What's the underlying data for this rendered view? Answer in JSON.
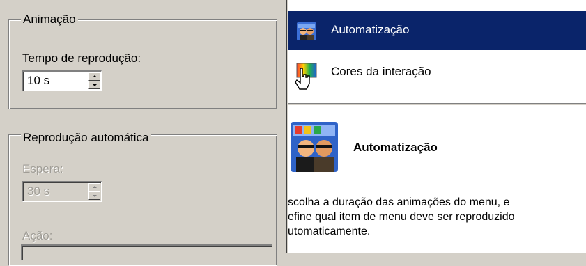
{
  "animation_group": {
    "title": "Animação",
    "playback_time_label": "Tempo de reprodução:",
    "playback_time_value": "10 s"
  },
  "autoplay_group": {
    "title": "Reprodução automática",
    "wait_label": "Espera:",
    "wait_value": "30 s",
    "action_label": "Ação:"
  },
  "menu": {
    "items": [
      {
        "label": "Automatização",
        "icon": "people-automation-icon",
        "selected": true
      },
      {
        "label": "Cores da interação",
        "icon": "color-gradient-icon",
        "selected": false
      }
    ]
  },
  "description": {
    "title": "Automatização",
    "lines": [
      "scolha a duração das animações do menu, e",
      "efine qual item de menu deve ser reproduzido",
      "utomaticamente."
    ]
  },
  "colors": {
    "selection": "#0a246a",
    "face": "#d4d0c8",
    "disabled_text": "#a09d96"
  }
}
